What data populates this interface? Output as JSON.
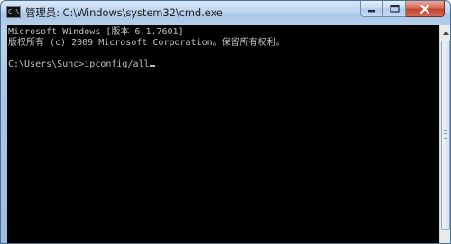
{
  "window": {
    "title": "管理员: C:\\Windows\\system32\\cmd.exe",
    "icon_text": "C:\\"
  },
  "controls": {
    "minimize_icon": "minimize-icon",
    "maximize_icon": "maximize-icon",
    "close_icon": "close-icon"
  },
  "console": {
    "lines": [
      "Microsoft Windows [版本 6.1.7601]",
      "版权所有 (c) 2009 Microsoft Corporation。保留所有权利。",
      "",
      "C:\\Users\\Sunc>ipconfig/all"
    ]
  },
  "colors": {
    "console_background": "#000000",
    "console_text": "#c0c0c0",
    "close_button": "#c2432b"
  }
}
